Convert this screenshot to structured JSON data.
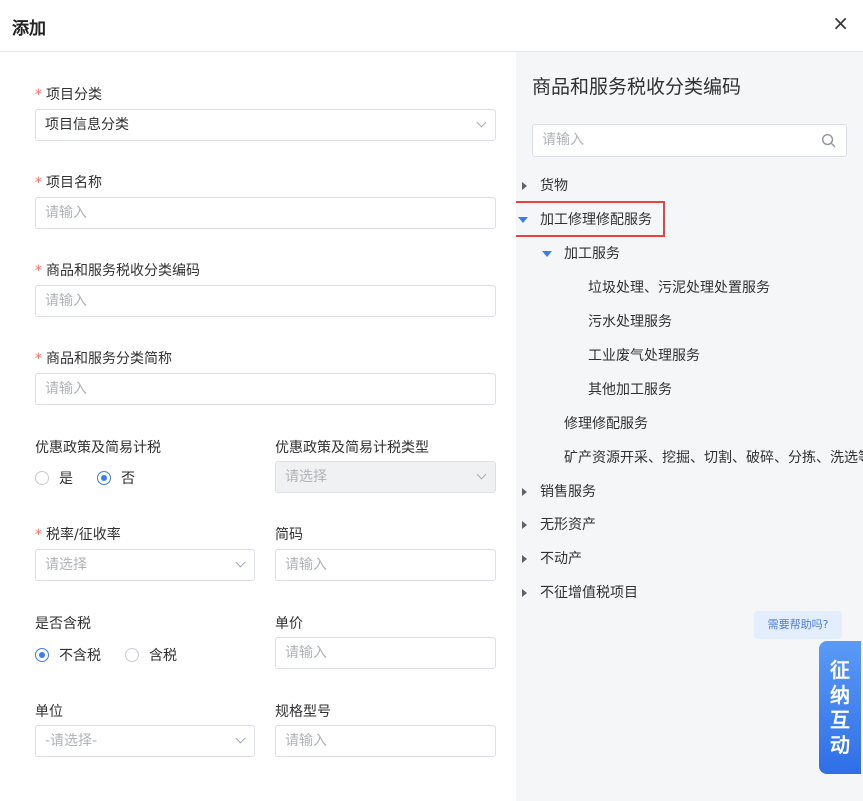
{
  "dialog": {
    "title": "添加",
    "close": "×"
  },
  "form": {
    "category": {
      "label": "项目分类",
      "value": "项目信息分类"
    },
    "name": {
      "label": "项目名称",
      "placeholder": "请输入"
    },
    "tax_code": {
      "label": "商品和服务税收分类编码",
      "placeholder": "请输入"
    },
    "short_name": {
      "label": "商品和服务分类简称",
      "placeholder": "请输入"
    },
    "preferential": {
      "label": "优惠政策及简易计税",
      "options": [
        "是",
        "否"
      ],
      "selected": "否"
    },
    "preferential_type": {
      "label": "优惠政策及简易计税类型",
      "placeholder": "请选择"
    },
    "tax_rate": {
      "label": "税率/征收率",
      "placeholder": "请选择"
    },
    "abbr": {
      "label": "简码",
      "placeholder": "请输入"
    },
    "tax_included": {
      "label": "是否含税",
      "options": [
        "不含税",
        "含税"
      ],
      "selected": "不含税"
    },
    "price": {
      "label": "单价",
      "placeholder": "请输入"
    },
    "unit": {
      "label": "单位",
      "placeholder": "-请选择-"
    },
    "spec": {
      "label": "规格型号",
      "placeholder": "请输入"
    }
  },
  "panel": {
    "title": "商品和服务税收分类编码",
    "search_placeholder": "请输入",
    "tree": [
      {
        "label": "货物",
        "level": 0,
        "state": "collapsed"
      },
      {
        "label": "加工修理修配服务",
        "level": 0,
        "state": "expanded",
        "highlighted": true
      },
      {
        "label": "加工服务",
        "level": 1,
        "state": "expanded"
      },
      {
        "label": "垃圾处理、污泥处理处置服务",
        "level": 2
      },
      {
        "label": "污水处理服务",
        "level": 2
      },
      {
        "label": "工业废气处理服务",
        "level": 2
      },
      {
        "label": "其他加工服务",
        "level": 2
      },
      {
        "label": "修理修配服务",
        "level": 1
      },
      {
        "label": "矿产资源开采、挖掘、切割、破碎、分拣、洗选等",
        "level": 1
      },
      {
        "label": "销售服务",
        "level": 0,
        "state": "collapsed"
      },
      {
        "label": "无形资产",
        "level": 0,
        "state": "collapsed"
      },
      {
        "label": "不动产",
        "level": 0,
        "state": "collapsed"
      },
      {
        "label": "不征增值税项目",
        "level": 0,
        "state": "collapsed"
      }
    ]
  },
  "help": {
    "bubble": "需要帮助吗?",
    "widget": [
      "征",
      "纳",
      "互",
      "动"
    ]
  },
  "colors": {
    "primary": "#3b7df0",
    "required": "#f56c6c",
    "highlight": "#e84343"
  }
}
